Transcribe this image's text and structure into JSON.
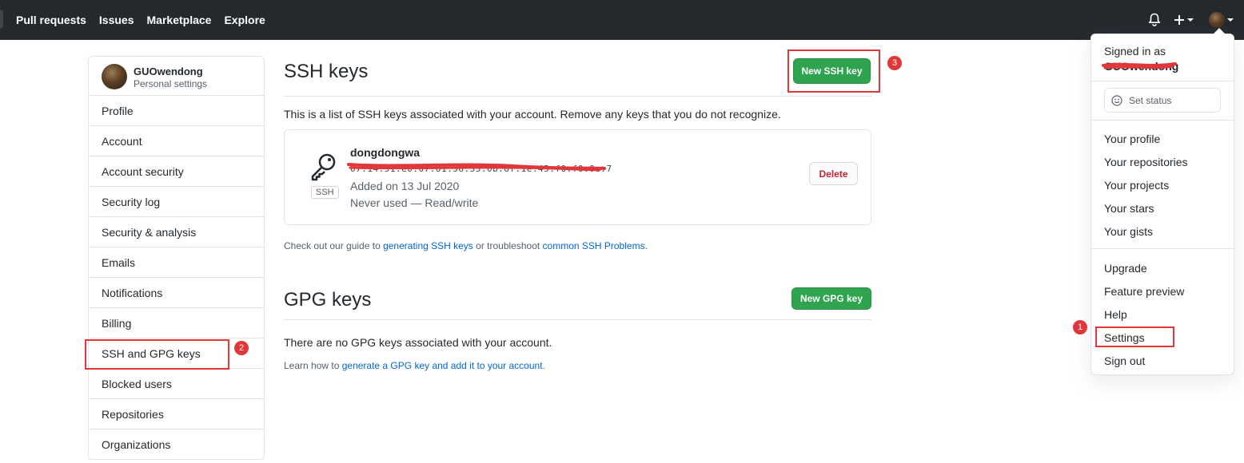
{
  "nav": {
    "pull_requests": "Pull requests",
    "issues": "Issues",
    "marketplace": "Marketplace",
    "explore": "Explore"
  },
  "sidebar": {
    "user_name": "GUOwendong",
    "user_sub": "Personal settings",
    "items": [
      {
        "label": "Profile"
      },
      {
        "label": "Account"
      },
      {
        "label": "Account security"
      },
      {
        "label": "Security log"
      },
      {
        "label": "Security & analysis"
      },
      {
        "label": "Emails"
      },
      {
        "label": "Notifications"
      },
      {
        "label": "Billing"
      },
      {
        "label": "SSH and GPG keys"
      },
      {
        "label": "Blocked users"
      },
      {
        "label": "Repositories"
      },
      {
        "label": "Organizations"
      }
    ]
  },
  "ssh": {
    "title": "SSH keys",
    "new_button": "New SSH key",
    "description": "This is a list of SSH keys associated with your account. Remove any keys that you do not recognize.",
    "key": {
      "title": "dongdongwa",
      "fingerprint": "07:14:51:e0:07:01:56:55:0b:8f:1e:45:f0:f0:0e:7",
      "type_label": "SSH",
      "added": "Added on 13 Jul 2020",
      "usage": "Never used — Read/write",
      "delete_label": "Delete"
    },
    "guide": {
      "prefix": "Check out our guide to ",
      "link1": "generating SSH keys",
      "middle": " or troubleshoot ",
      "link2": "common SSH Problems",
      "suffix": "."
    }
  },
  "gpg": {
    "title": "GPG keys",
    "new_button": "New GPG key",
    "empty_text": "There are no GPG keys associated with your account.",
    "learn": {
      "prefix": "Learn how to ",
      "link": "generate a GPG key and add it to your account",
      "suffix": "."
    }
  },
  "dropdown": {
    "signed_in_as": "Signed in as",
    "username": "GUOwendong",
    "set_status": "Set status",
    "group1": [
      "Your profile",
      "Your repositories",
      "Your projects",
      "Your stars",
      "Your gists"
    ],
    "group2": [
      "Upgrade",
      "Feature preview",
      "Help",
      "Settings",
      "Sign out"
    ]
  },
  "annotations": {
    "badge1": "1",
    "badge2": "2",
    "badge3": "3"
  },
  "colors": {
    "header_bg": "#24292e",
    "primary_green": "#2ea44f",
    "link_blue": "#0366d6",
    "annotation_red": "#e0373b",
    "delete_red": "#cb2431"
  }
}
